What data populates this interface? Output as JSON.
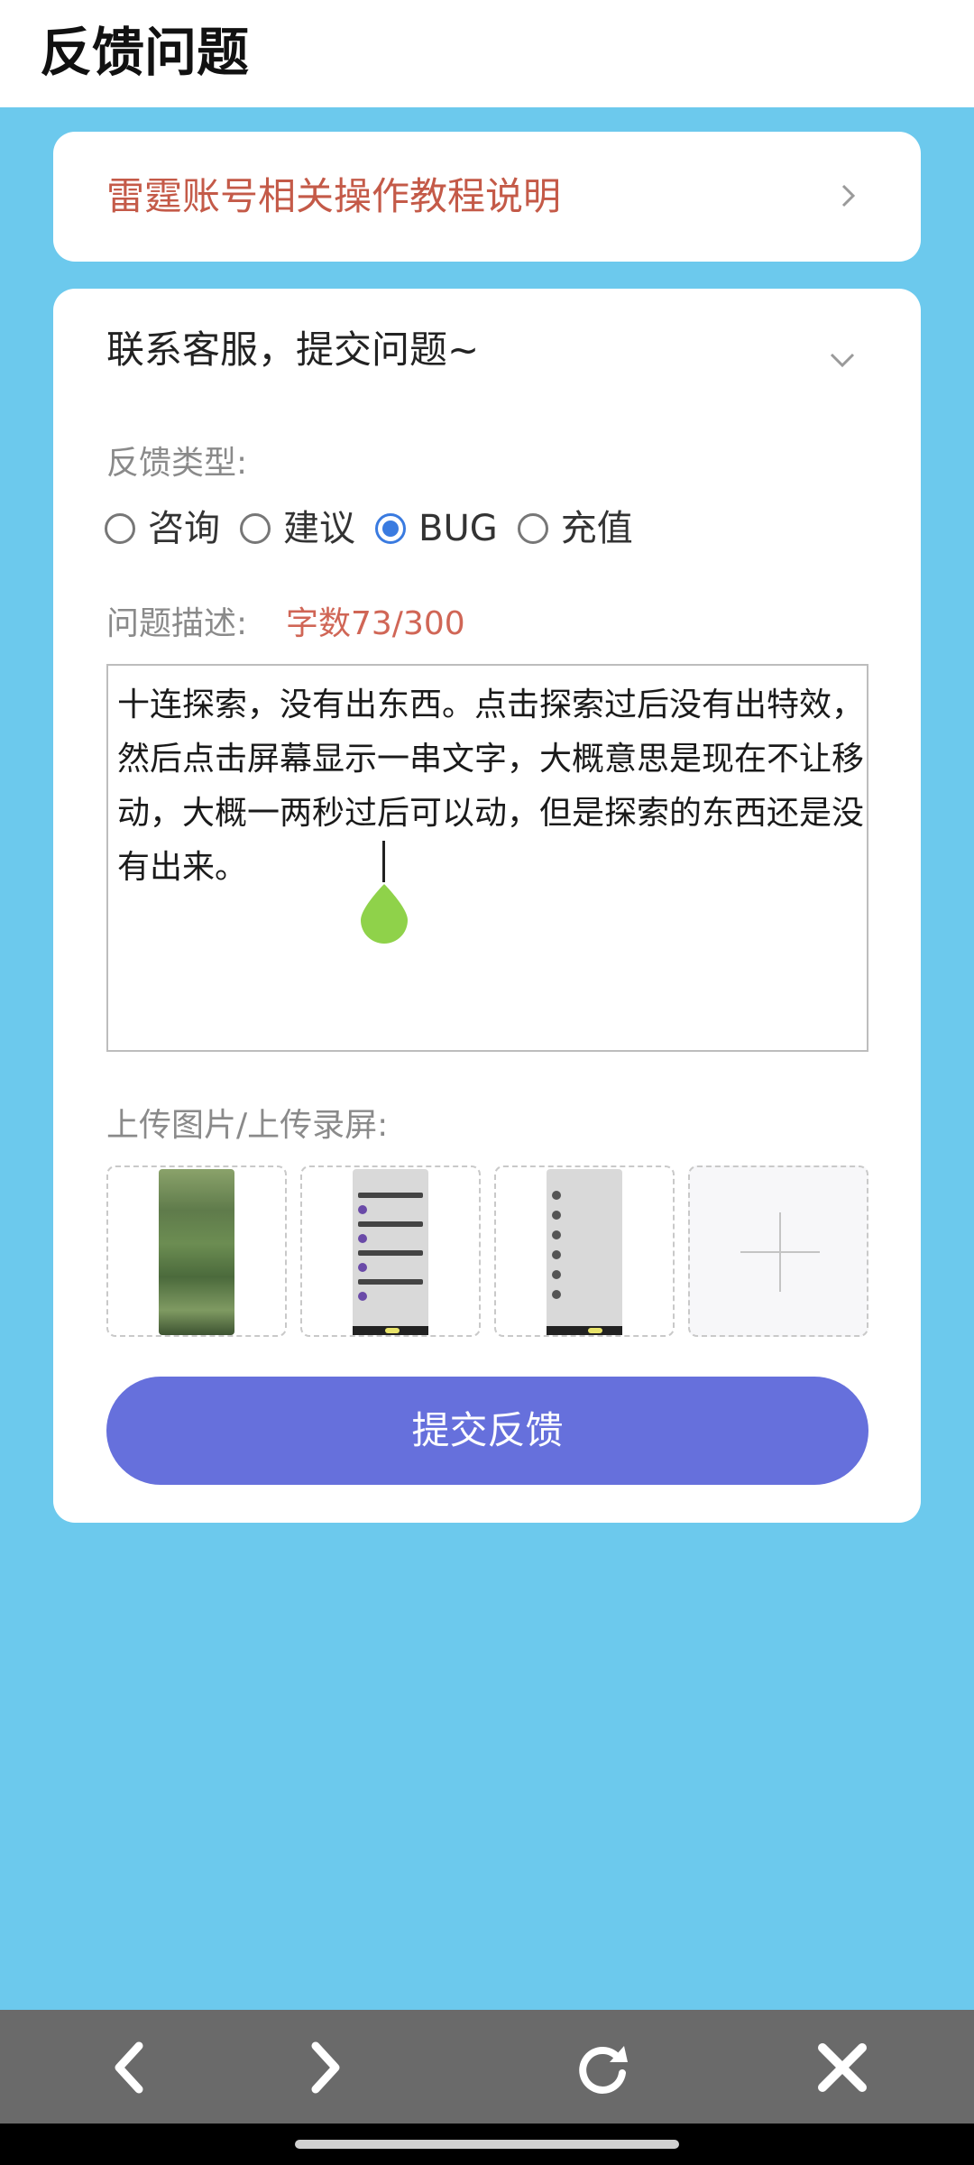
{
  "header": {
    "title": "反馈问题"
  },
  "tutorial": {
    "label": "雷霆账号相关操作教程说明"
  },
  "form": {
    "section_title": "联系客服，提交问题~",
    "type_label": "反馈类型:",
    "types": [
      {
        "label": "咨询",
        "selected": false
      },
      {
        "label": "建议",
        "selected": false
      },
      {
        "label": "BUG",
        "selected": true
      },
      {
        "label": "充值",
        "selected": false
      }
    ],
    "desc_label": "问题描述:",
    "char_count": "字数73/300",
    "description": "十连探索，没有出东西。点击探索过后没有出特效，然后点击屏幕显示一串文字，大概意思是现在不让移动，大概一两秒过后可以动，但是探索的东西还是没有出来。",
    "upload_label": "上传图片/上传录屏:",
    "submit_label": "提交反馈"
  },
  "colors": {
    "background": "#6cc9ed",
    "accent_text": "#c45a48",
    "submit": "#6670dc",
    "radio_selected": "#3a7be0",
    "nav_bar": "#6a6a6a",
    "cursor_handle": "#8fd24a"
  },
  "icons": {
    "tutorial_chevron": "chevron-right-icon",
    "section_chevron": "chevron-down-icon",
    "nav_back": "back-icon",
    "nav_forward": "forward-icon",
    "nav_refresh": "refresh-icon",
    "nav_close": "close-icon",
    "add_upload": "plus-icon"
  }
}
